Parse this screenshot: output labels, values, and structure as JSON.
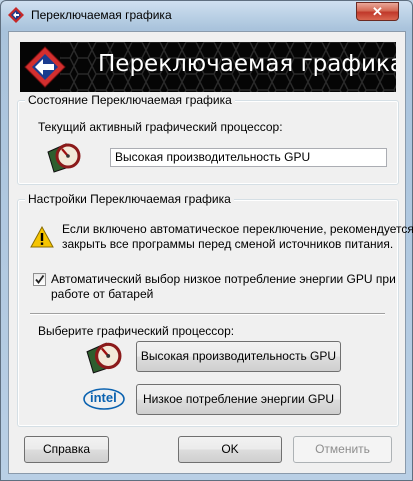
{
  "window": {
    "title": "Переключаемая графика",
    "close_glyph": "✕"
  },
  "banner": {
    "title": "Переключаемая графика",
    "logo_icon": "amd-switchable-graphics-logo"
  },
  "status_group": {
    "legend": "Состояние Переключаемая графика",
    "current_gpu_label": "Текущий активный графический процессор:",
    "current_gpu_value": "Высокая производительность GPU",
    "gpu_icon": "high-performance-gpu-gauge-icon"
  },
  "settings_group": {
    "legend": "Настройки Переключаемая графика",
    "warning_icon": "warning-icon",
    "warning_line1": "Если включено автоматическое переключение, рекомендуется",
    "warning_line2": "закрыть все программы перед сменой источников питания.",
    "auto_checkbox_checked": true,
    "auto_line1": "Автоматический выбор низкое потребление энергии GPU при",
    "auto_line2": "работе от батарей",
    "select_label": "Выберите графический процессор:",
    "high_perf_button": "Высокая производительность GPU",
    "low_power_button": "Низкое потребление энергии GPU",
    "intel_logo_text": "intel"
  },
  "footer": {
    "help": "Справка",
    "ok": "OK",
    "cancel": "Отменить"
  }
}
